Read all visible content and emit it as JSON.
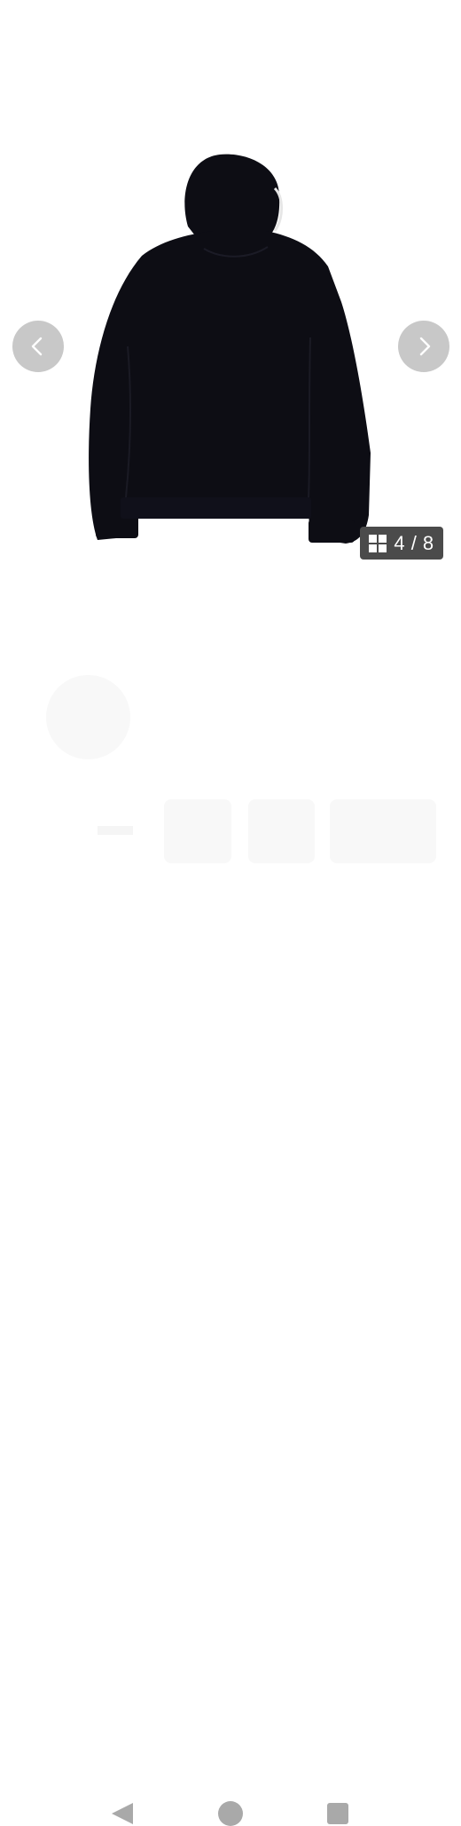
{
  "gallery": {
    "product_image": "hoodie-back-view",
    "current_index": 4,
    "total": 8,
    "counter_text": "4 / 8",
    "prev_icon": "chevron-left-icon",
    "next_icon": "chevron-right-icon",
    "counter_icon": "grid-icon"
  },
  "colors": {
    "garment": "#0d0d14",
    "nav_button": "#c8c8c8",
    "counter_bg": "#4b4b4b",
    "system_nav": "#a9a9a9"
  },
  "system_nav": {
    "back_icon": "back-triangle-icon",
    "home_icon": "home-circle-icon",
    "recents_icon": "recents-square-icon"
  }
}
